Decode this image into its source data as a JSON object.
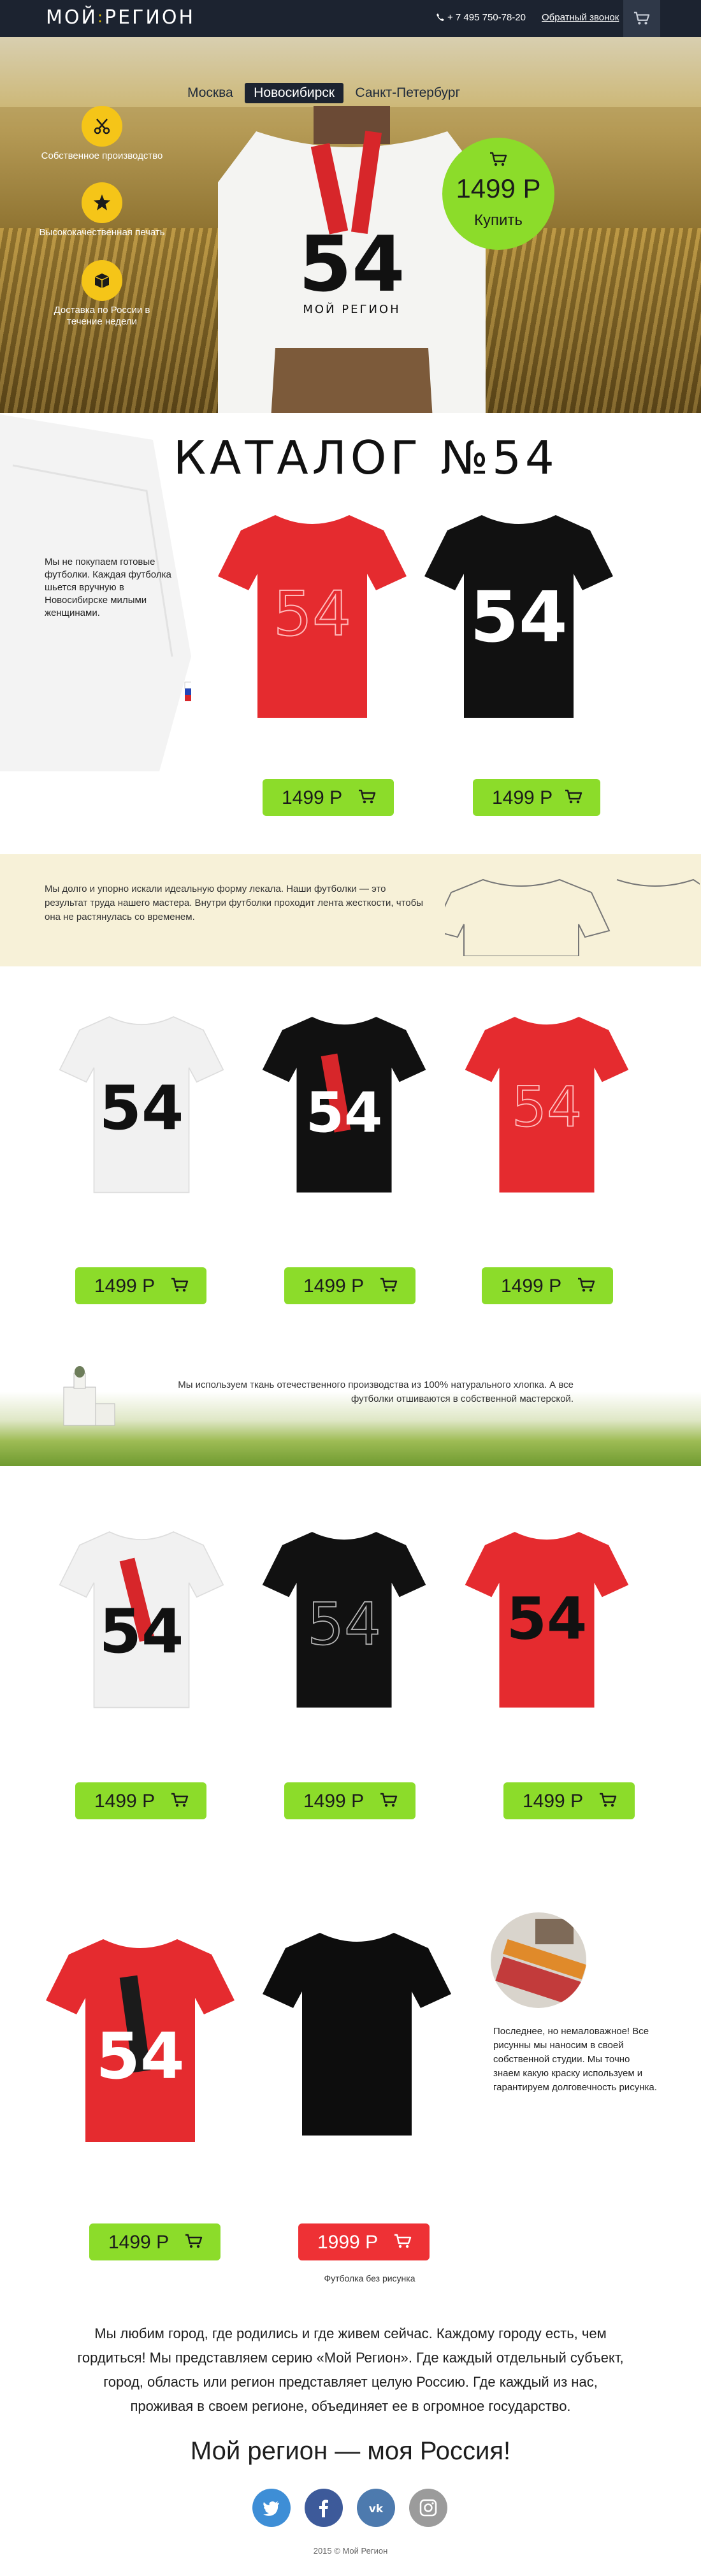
{
  "header": {
    "logo": "МОЙ",
    "logo_sep": ":",
    "logo_tail": "РЕГИОН",
    "phone": "+ 7 495 750-78-20",
    "callback": "Обратный звонок",
    "cart_icon": "cart-icon"
  },
  "hero": {
    "city_tabs": [
      "Москва",
      "Новосибирск",
      "Санкт-Петербург"
    ],
    "active_city": "Новосибирск",
    "features": [
      "Собственное производство",
      "Высококачественная печать",
      "Доставка по России в течение недели"
    ],
    "feature_icons": [
      "scissors-icon",
      "star-icon",
      "box-icon"
    ],
    "price": "1499 Р",
    "buy_label": "Купить",
    "shirt_number": "54",
    "shirt_brand": "МОЙ РЕГИОН"
  },
  "catalog": {
    "title": "КАТАЛОГ №54",
    "sleeve_text": "Мы не покупаем готовые футболки. Каждая футболка шьется вручную в Новосибирске милыми женщинами.",
    "row1": [
      "1499 Р",
      "1499 Р"
    ],
    "info_text": "Мы долго и упорно искали идеальную форму лекала. Наши футболки — это результат труда нашего мастера. Внутри футболки проходит лента жесткости, чтобы она не растянулась со временем.",
    "row2": [
      "1499 Р",
      "1499 Р",
      "1499 Р"
    ],
    "field_text": "Мы используем ткань отечественного производства из 100% натурального хлопка. А все футболки отшиваются в собственной мастерской.",
    "row3": [
      "1499 Р",
      "1499 Р",
      "1499 Р"
    ],
    "row4": [
      "1499 Р",
      "1999 Р"
    ],
    "note": "Последнее, но немаловажное! Все рисунны мы наносим в своей собственной студии. Мы точно знаем какую краску используем и гарантируем долговечность рисунка.",
    "blank_caption": "Футболка без рисунка"
  },
  "footer": {
    "about": "Мы любим город, где родились и где живем сейчас. Каждому городу есть, чем гордиться! Мы представляем серию «Мой Регион». Где каждый отдельный субъект, город, область или регион представляет целую Россию. Где каждый из нас, проживая в своем регионе, объединяет ее в огромное государство.",
    "slogan": "Мой регион — моя Россия!",
    "socials": [
      "twitter-icon",
      "facebook-icon",
      "vk-icon",
      "instagram-icon"
    ],
    "copyright": "2015 © Мой Регион"
  },
  "colors": {
    "accent_green": "#8cdc2a",
    "accent_red": "#ee3135",
    "header_bg": "#1c2330",
    "brand_yellow": "#f5c518"
  }
}
